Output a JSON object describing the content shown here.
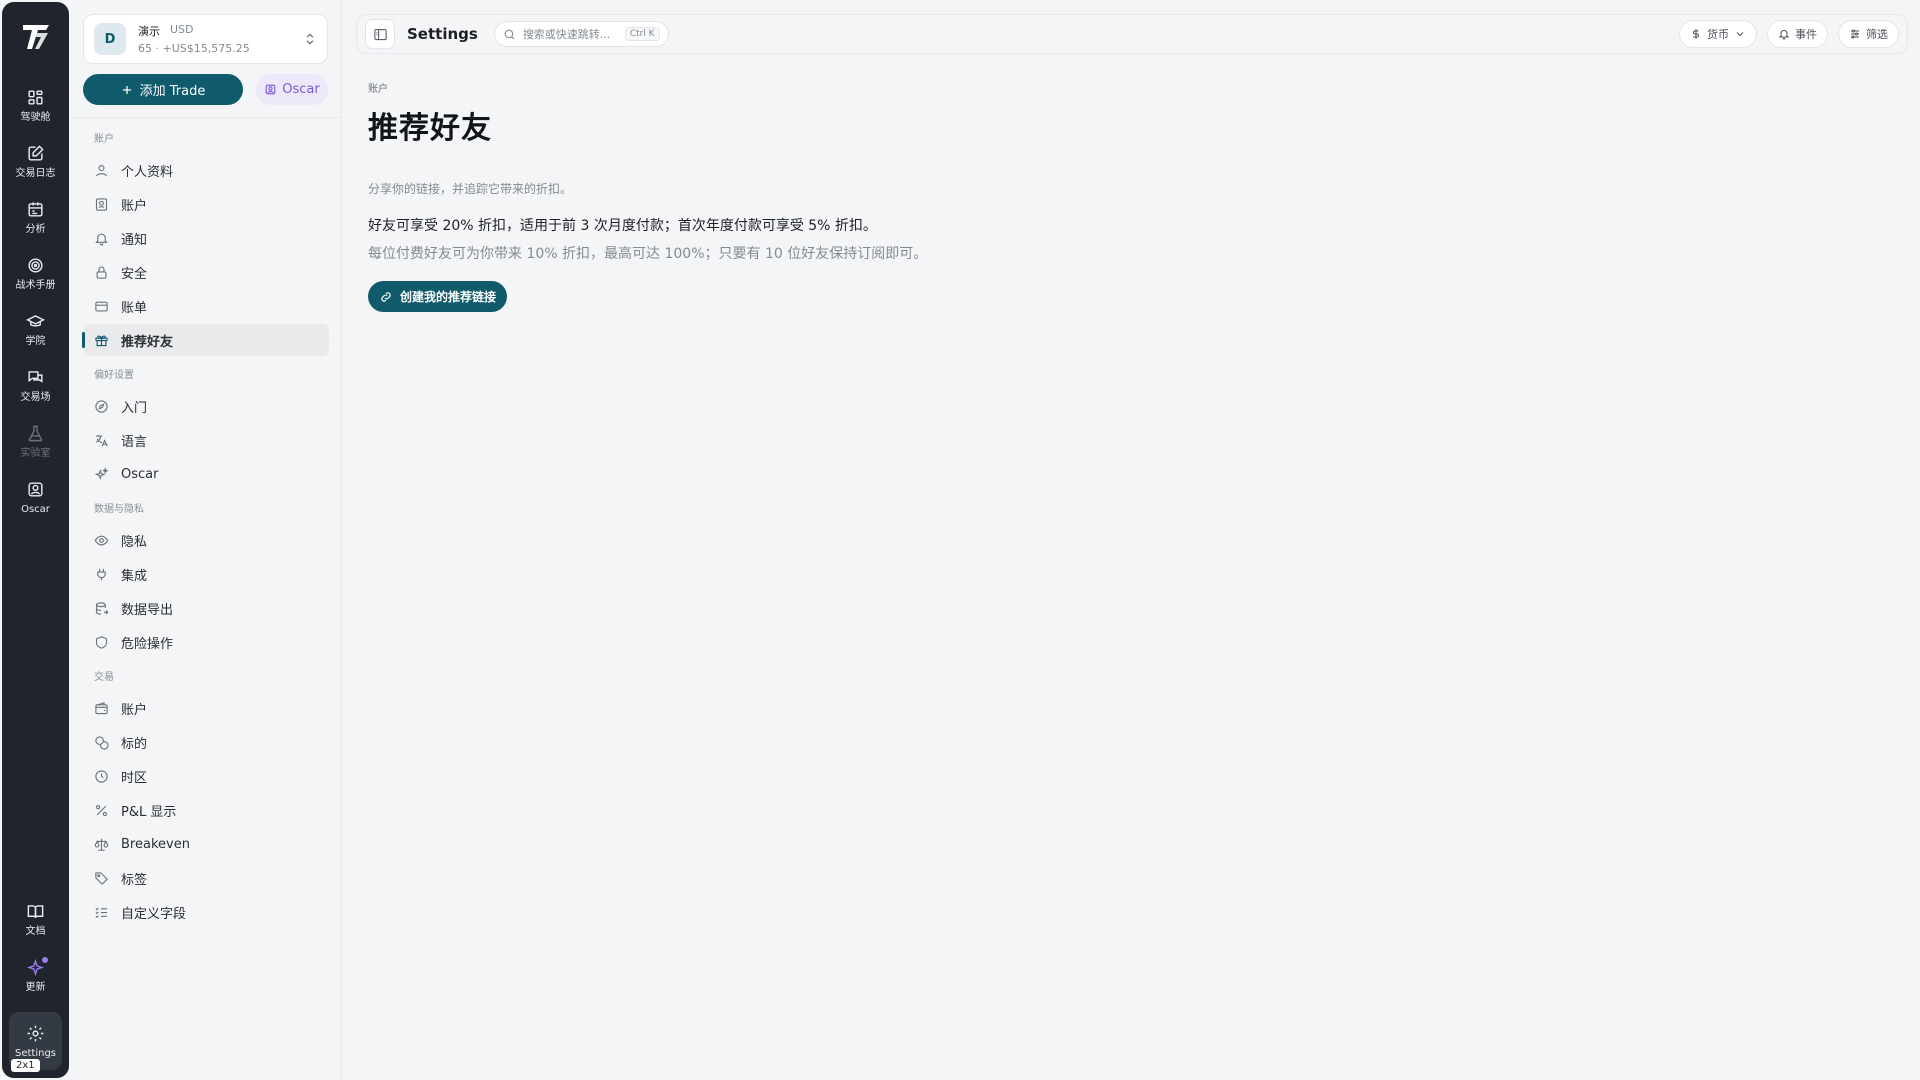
{
  "rail": {
    "items": [
      {
        "label": "驾驶舱",
        "icon": "dashboard-icon"
      },
      {
        "label": "交易日志",
        "icon": "journal-icon"
      },
      {
        "label": "分析",
        "icon": "calendar-icon"
      },
      {
        "label": "战术手册",
        "icon": "target-icon"
      },
      {
        "label": "学院",
        "icon": "graduation-cap-icon"
      },
      {
        "label": "交易场",
        "icon": "chat-icon"
      },
      {
        "label": "实验室",
        "icon": "flask-icon"
      },
      {
        "label": "Oscar",
        "icon": "oscar-icon"
      }
    ],
    "docs_label": "文档",
    "updates_label": "更新",
    "settings_label": "Settings",
    "zoom_badge": "2x1"
  },
  "account": {
    "avatar_initial": "D",
    "name": "演示",
    "currency": "USD",
    "summary": "65 · +US$15,575.25"
  },
  "actions": {
    "add_trade": "添加 Trade",
    "oscar": "Oscar"
  },
  "sidebar": {
    "sections": [
      {
        "title": "账户",
        "items": [
          "个人资料",
          "账户",
          "通知",
          "安全",
          "账单",
          "推荐好友"
        ]
      },
      {
        "title": "偏好设置",
        "items": [
          "入门",
          "语言",
          "Oscar"
        ]
      },
      {
        "title": "数据与隐私",
        "items": [
          "隐私",
          "集成",
          "数据导出",
          "危险操作"
        ]
      },
      {
        "title": "交易",
        "items": [
          "账户",
          "标的",
          "时区",
          "P&L 显示",
          "Breakeven",
          "标签",
          "自定义字段"
        ]
      }
    ]
  },
  "topbar": {
    "title": "Settings",
    "search_placeholder": "搜索或快速跳转...",
    "shortcut": "Ctrl K",
    "currency": "货币",
    "events": "事件",
    "filter": "筛选"
  },
  "main": {
    "breadcrumb": "账户",
    "title": "推荐好友",
    "description": "分享你的链接，并追踪它带来的折扣。",
    "benefit_line": "好友可享受 20% 折扣，适用于前 3 次月度付款；首次年度付款可享受 5% 折扣。",
    "reward_line": "每位付费好友可为你带来 10% 折扣，最高可达 100%；只要有 10 位好友保持订阅即可。",
    "create_link_button": "创建我的推荐链接"
  },
  "colors": {
    "accent": "#0f5a6b",
    "rail_bg": "#20252d",
    "oscar_purple": "#7b57d6"
  }
}
